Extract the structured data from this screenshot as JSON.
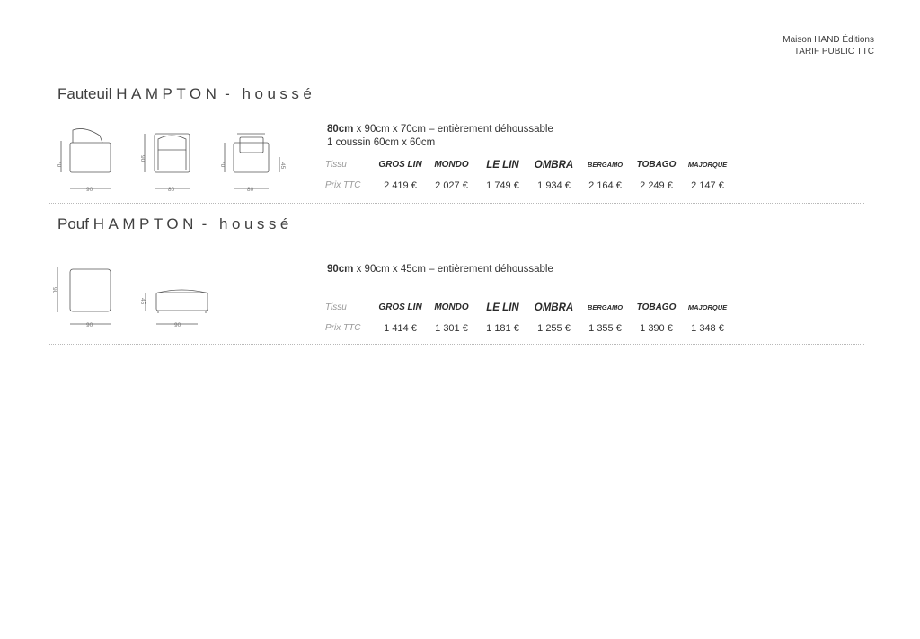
{
  "header": {
    "line1": "Maison HAND Éditions",
    "line2": "TARIF PUBLIC TTC"
  },
  "products": [
    {
      "title_prefix": "Fauteuil",
      "title_name": "HAMPTON",
      "title_suffix": "- houssé",
      "dims_bold": "80cm",
      "dims_rest": " x 90cm x 70cm – entièrement déhoussable",
      "desc_line2": "1 coussin 60cm x 60cm",
      "label_fabric": "Tissu",
      "label_price": "Prix TTC",
      "fabrics": [
        "GROS LIN",
        "MONDO",
        "LE LIN",
        "OMBRA",
        "BERGAMO",
        "TOBAGO",
        "MAJORQUE"
      ],
      "prices": [
        "2 419 €",
        "2 027 €",
        "1 749 €",
        "1 934 €",
        "2 164 €",
        "2 249 €",
        "2 147 €"
      ],
      "drawing_dims": {
        "side_h": "70",
        "side_w": "90",
        "front_h": "90",
        "front_w": "80",
        "back_h": "70",
        "back_w": "80",
        "seat_h": "45"
      }
    },
    {
      "title_prefix": "Pouf",
      "title_name": "HAMPTON",
      "title_suffix": "- houssé",
      "dims_bold": "90cm",
      "dims_rest": " x 90cm x 45cm – entièrement déhoussable",
      "label_fabric": "Tissu",
      "label_price": "Prix TTC",
      "fabrics": [
        "GROS LIN",
        "MONDO",
        "LE LIN",
        "OMBRA",
        "BERGAMO",
        "TOBAGO",
        "MAJORQUE"
      ],
      "prices": [
        "1 414 €",
        "1 301 €",
        "1 181 €",
        "1 255 €",
        "1 355 €",
        "1 390 €",
        "1 348 €"
      ],
      "drawing_dims": {
        "top_h": "90",
        "top_w": "90",
        "side_h": "45",
        "side_w": "90"
      }
    }
  ]
}
